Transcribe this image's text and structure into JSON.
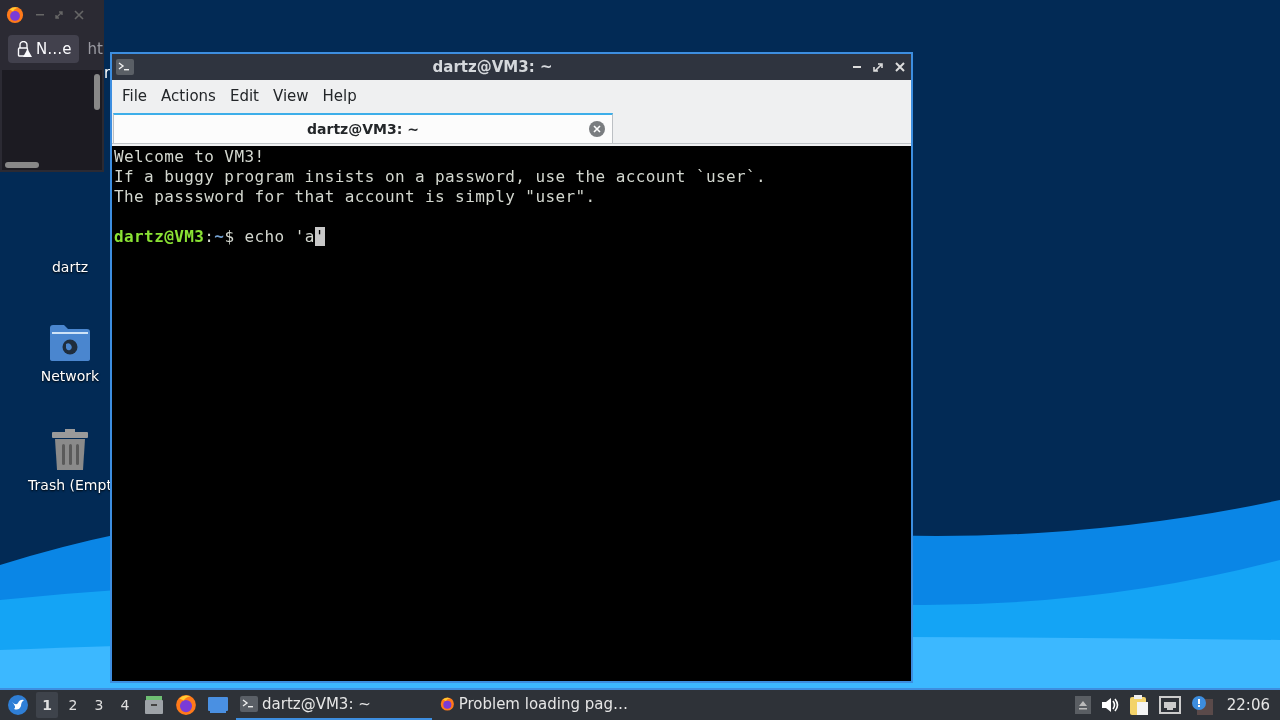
{
  "desktop_icons": [
    {
      "label": "dartz",
      "kind": "covered"
    },
    {
      "label": "Network",
      "kind": "network"
    },
    {
      "label": "Trash (Empt",
      "kind": "trash"
    }
  ],
  "browser_window": {
    "tab": {
      "label": "N…e",
      "selected": true
    },
    "next_tab": {
      "label": "ht"
    },
    "peek_text": "r"
  },
  "terminal": {
    "title": "dartz@VM3: ~",
    "menu": [
      "File",
      "Actions",
      "Edit",
      "View",
      "Help"
    ],
    "tabs": [
      {
        "label": "dartz@VM3: ~",
        "selected": true
      }
    ],
    "lines": [
      {
        "kind": "text",
        "text": "Welcome to VM3!"
      },
      {
        "kind": "text",
        "text": "If a buggy program insists on a password, use the account `user`."
      },
      {
        "kind": "text",
        "text": "The passsword for that account is simply \"user\"."
      },
      {
        "kind": "blank"
      },
      {
        "kind": "prompt",
        "user_host": "dartz@VM3",
        "separator": ":",
        "path": "~",
        "symbol": "$",
        "command": " echo 'a",
        "cursor_char": "'"
      }
    ]
  },
  "taskbar": {
    "workspaces": [
      {
        "label": "1",
        "selected": true
      },
      {
        "label": "2",
        "selected": false
      },
      {
        "label": "3",
        "selected": false
      },
      {
        "label": "4",
        "selected": false
      }
    ],
    "tasks": [
      {
        "kind": "terminal",
        "label": "dartz@VM3: ~",
        "selected": true
      },
      {
        "kind": "firefox",
        "label": "Problem loading pag…",
        "selected": false
      }
    ],
    "clock": "22:06"
  }
}
